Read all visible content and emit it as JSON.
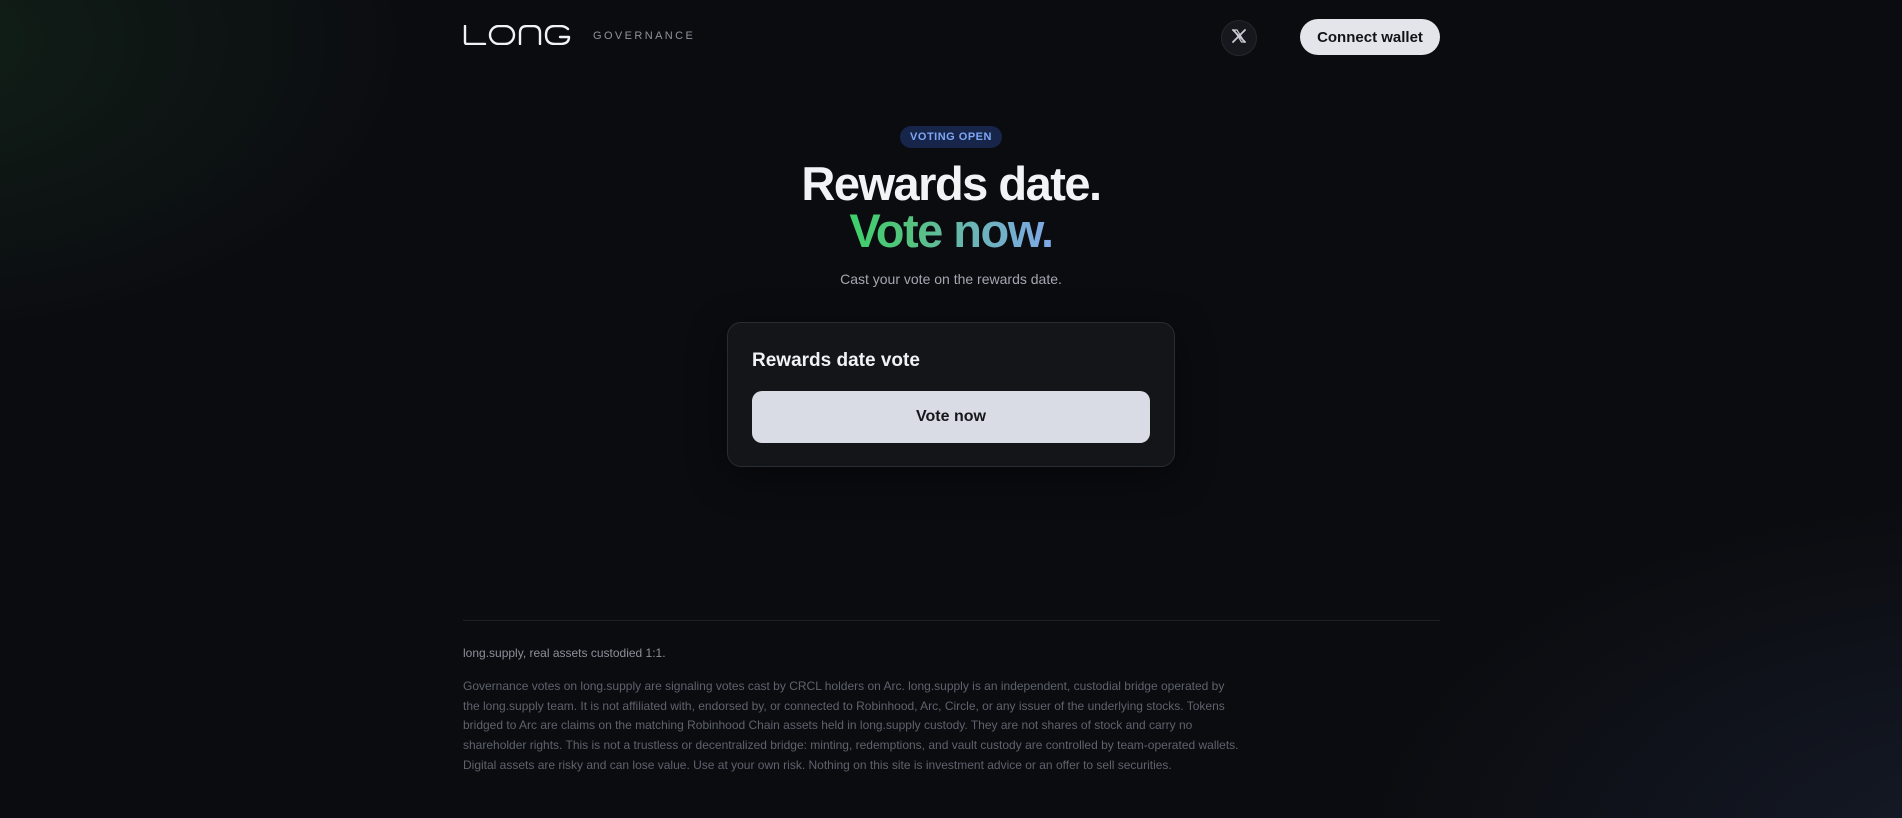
{
  "header": {
    "logo_text": "LONG",
    "logo_subtitle": "GOVERNANCE",
    "x_icon": "x-logo-icon",
    "connect_label": "Connect wallet"
  },
  "hero": {
    "badge": "VOTING OPEN",
    "title_line1": "Rewards date.",
    "title_line2": "Vote now.",
    "subtitle": "Cast your vote on the rewards date."
  },
  "card": {
    "title": "Rewards date vote",
    "button_label": "Vote now"
  },
  "footer": {
    "tagline": "long.supply, real assets custodied 1:1.",
    "disclaimer": "Governance votes on long.supply are signaling votes cast by CRCL holders on Arc. long.supply is an independent, custodial bridge operated by the long.supply team. It is not affiliated with, endorsed by, or connected to Robinhood, Arc, Circle, or any issuer of the underlying stocks. Tokens bridged to Arc are claims on the matching Robinhood Chain assets held in long.supply custody. They are not shares of stock and carry no shareholder rights. This is not a trustless or decentralized bridge: minting, redemptions, and vault custody are controlled by team-operated wallets. Digital assets are risky and can lose value. Use at your own risk. Nothing on this site is investment advice or an offer to sell securities."
  },
  "colors": {
    "background": "#0b0c10",
    "accent_green": "#3dd06b",
    "accent_blue": "#7fa8e8",
    "badge_bg": "#17254a",
    "badge_text": "#7ea6f5"
  }
}
